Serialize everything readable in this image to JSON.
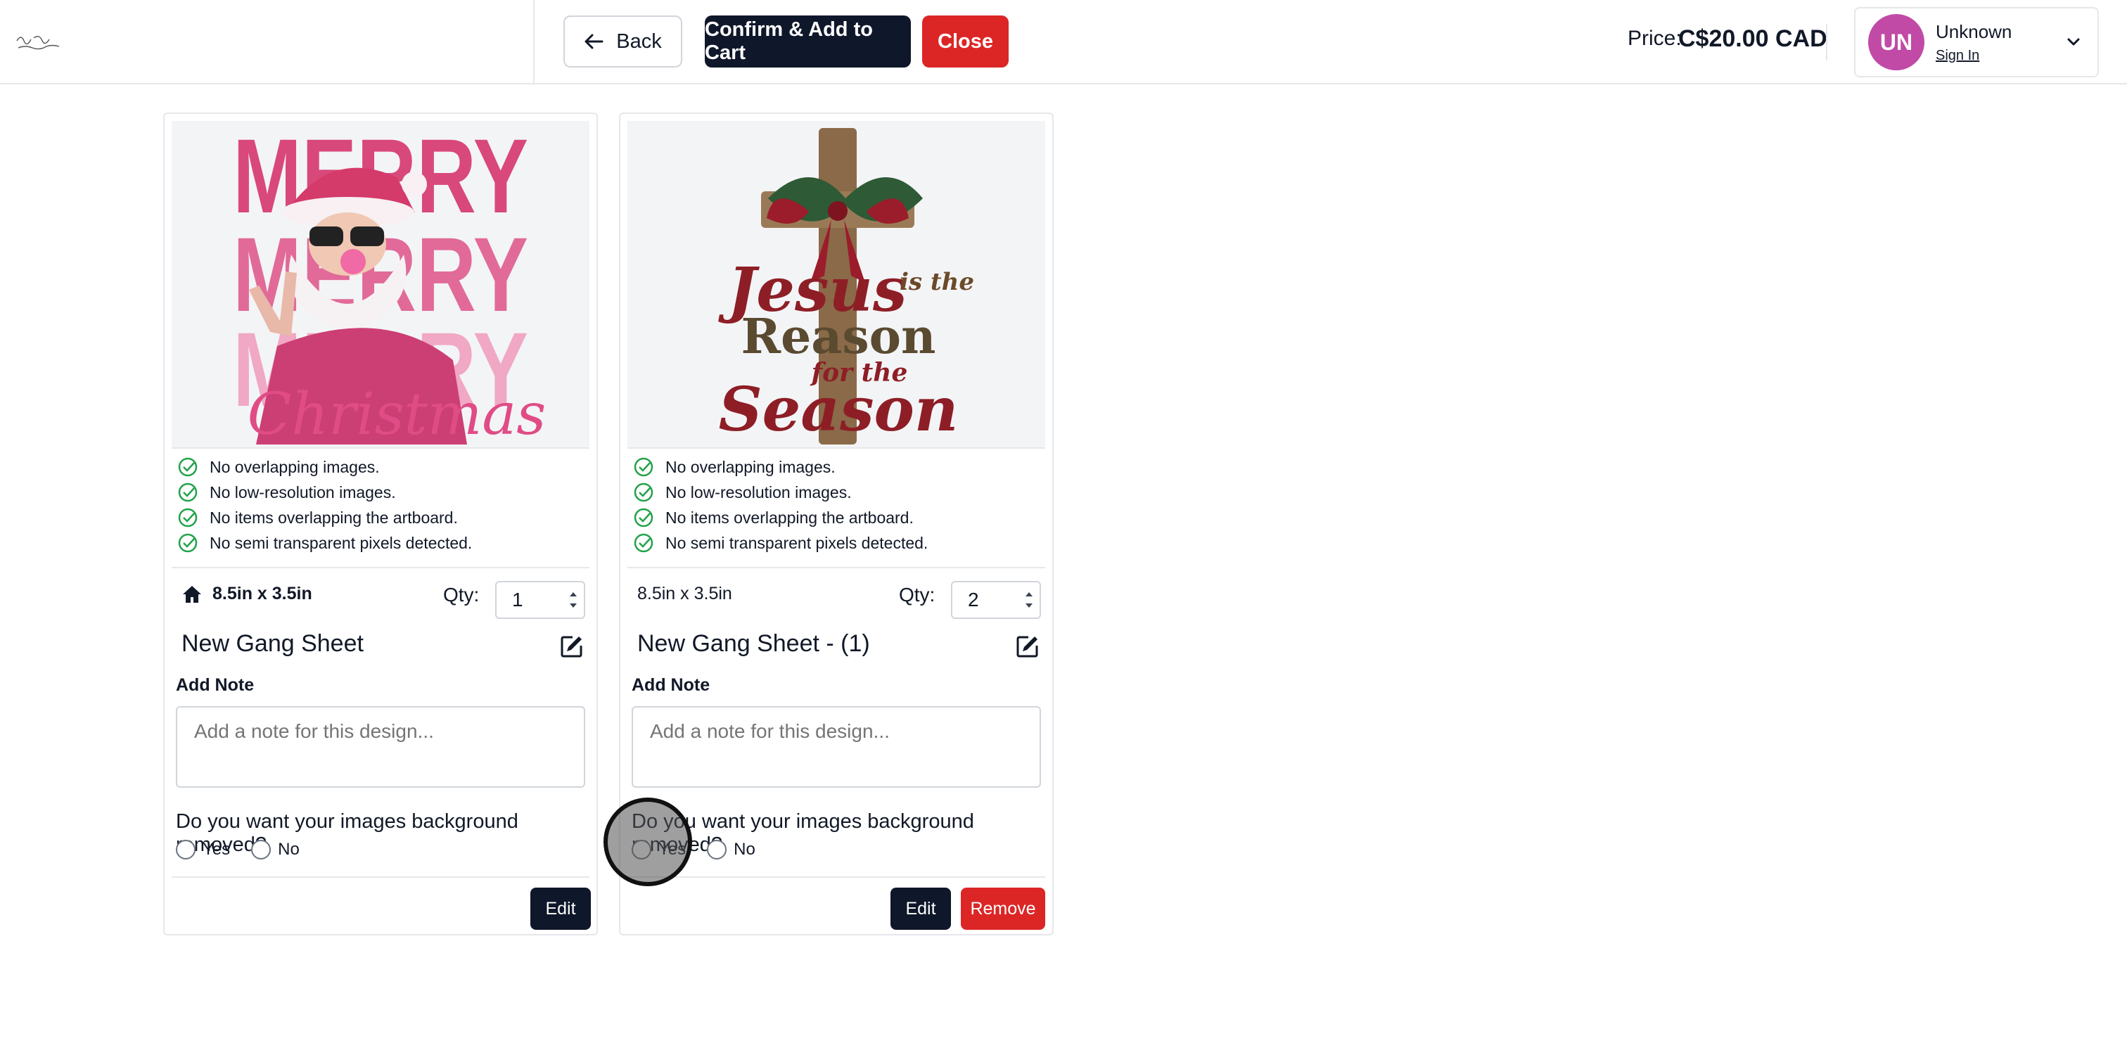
{
  "header": {
    "logo_text": "Cards by Noor Lettering",
    "back_label": "Back",
    "confirm_label": "Confirm & Add to Cart",
    "close_label": "Close",
    "price_label": "Price:",
    "price_value": "C$20.00 CAD",
    "user": {
      "initials": "UN",
      "name": "Unknown",
      "sign_in_label": "Sign In"
    }
  },
  "common": {
    "checks": [
      "No overlapping images.",
      "No low-resolution images.",
      "No items overlapping the artboard.",
      "No semi transparent pixels detected."
    ],
    "qty_label": "Qty:",
    "add_note_label": "Add Note",
    "note_placeholder": "Add a note for this design...",
    "bg_question": "Do you want your images background removed?",
    "yes_label": "Yes",
    "no_label": "No",
    "edit_label": "Edit",
    "remove_label": "Remove"
  },
  "cards": [
    {
      "size": "8.5in x 3.5in",
      "qty": "1",
      "title": "New Gang Sheet",
      "design_text": [
        "MERRY",
        "MERRY",
        "MERRY",
        "Christmas"
      ]
    },
    {
      "size": "8.5in x 3.5in",
      "qty": "2",
      "title": "New Gang Sheet - (1)",
      "design_text": [
        "Jesus",
        "is the",
        "Reason",
        "for the",
        "Season"
      ]
    }
  ],
  "colors": {
    "primary": "#0f172a",
    "danger": "#dc2626",
    "check": "#22a24a",
    "avatar": "#c04aa6"
  }
}
